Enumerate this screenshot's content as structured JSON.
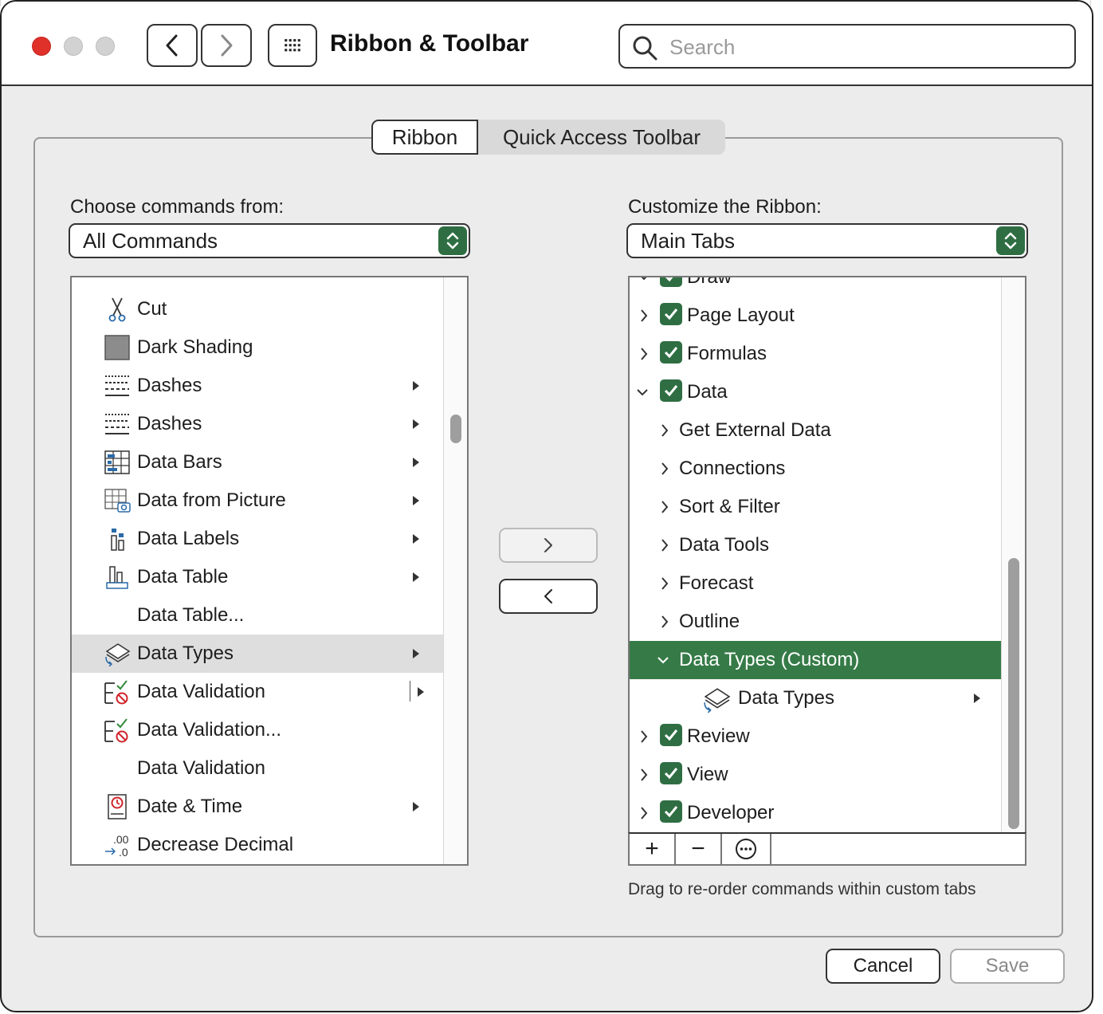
{
  "window": {
    "title": "Ribbon & Toolbar"
  },
  "search": {
    "placeholder": "Search"
  },
  "tabs": [
    {
      "label": "Ribbon",
      "selected": true
    },
    {
      "label": "Quick Access Toolbar",
      "selected": false
    }
  ],
  "left": {
    "label": "Choose commands from:",
    "dropdown_value": "All Commands",
    "items": [
      {
        "label": "Cut",
        "icon": "scissors-icon",
        "submenu": false
      },
      {
        "label": "Dark Shading",
        "icon": "dark-shading-icon",
        "submenu": false
      },
      {
        "label": "Dashes",
        "icon": "dashes-icon",
        "submenu": true
      },
      {
        "label": "Dashes",
        "icon": "dashes-icon",
        "submenu": true
      },
      {
        "label": "Data Bars",
        "icon": "data-bars-icon",
        "submenu": true
      },
      {
        "label": "Data from Picture",
        "icon": "data-from-picture-icon",
        "submenu": true
      },
      {
        "label": "Data Labels",
        "icon": "data-labels-icon",
        "submenu": true
      },
      {
        "label": "Data Table",
        "icon": "data-table-icon",
        "submenu": true
      },
      {
        "label": "Data Table...",
        "icon": "",
        "submenu": false
      },
      {
        "label": "Data Types",
        "icon": "data-types-icon",
        "submenu": true,
        "selected": true
      },
      {
        "label": "Data Validation",
        "icon": "data-validation-icon",
        "submenu": true
      },
      {
        "label": "Data Validation...",
        "icon": "data-validation-icon",
        "submenu": false
      },
      {
        "label": "Data Validation",
        "icon": "",
        "submenu": false
      },
      {
        "label": "Date & Time",
        "icon": "date-time-icon",
        "submenu": true
      },
      {
        "label": "Decrease Decimal",
        "icon": "decrease-decimal-icon",
        "submenu": false
      }
    ]
  },
  "right": {
    "label": "Customize the Ribbon:",
    "dropdown_value": "Main Tabs",
    "hint": "Drag to re-order commands within custom tabs",
    "tree": [
      {
        "label": "Draw",
        "level": 0,
        "checked": true,
        "expanded": true
      },
      {
        "label": "Page Layout",
        "level": 0,
        "checked": true,
        "expanded": false
      },
      {
        "label": "Formulas",
        "level": 0,
        "checked": true,
        "expanded": false
      },
      {
        "label": "Data",
        "level": 0,
        "checked": true,
        "expanded": true
      },
      {
        "label": "Get External Data",
        "level": 1,
        "expanded": false
      },
      {
        "label": "Connections",
        "level": 1,
        "expanded": false
      },
      {
        "label": "Sort & Filter",
        "level": 1,
        "expanded": false
      },
      {
        "label": "Data Tools",
        "level": 1,
        "expanded": false
      },
      {
        "label": "Forecast",
        "level": 1,
        "expanded": false
      },
      {
        "label": "Outline",
        "level": 1,
        "expanded": false
      },
      {
        "label": "Data Types (Custom)",
        "level": 1,
        "expanded": true,
        "selected": true
      },
      {
        "label": "Data Types",
        "level": 2,
        "submenu": true
      },
      {
        "label": "Review",
        "level": 0,
        "checked": true,
        "expanded": false
      },
      {
        "label": "View",
        "level": 0,
        "checked": true,
        "expanded": false
      },
      {
        "label": "Developer",
        "level": 0,
        "checked": true,
        "expanded": false
      }
    ],
    "toolbar": {
      "add": "+",
      "remove": "−",
      "more": "⋯"
    }
  },
  "buttons": {
    "cancel": "Cancel",
    "save": "Save"
  },
  "colors": {
    "accent": "#367b47",
    "close": "#e0302a"
  }
}
